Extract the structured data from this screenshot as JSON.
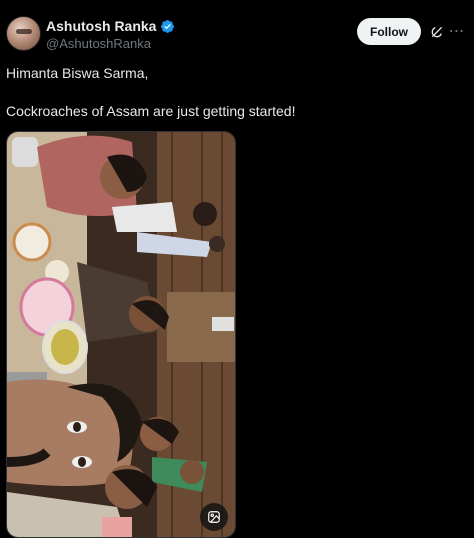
{
  "author": {
    "name": "Ashutosh Ranka",
    "handle": "@AshutoshRanka",
    "verified": true
  },
  "actions": {
    "follow_label": "Follow"
  },
  "post": {
    "line1": "Himanta Biswa Sarma,",
    "line2": "Cockroaches of Assam are just getting started!"
  },
  "colors": {
    "background": "#000000",
    "text": "#e7e9ea",
    "muted": "#71767b",
    "verified": "#1d9bf0",
    "follow_bg": "#eff3f4"
  },
  "icons": {
    "verified": "verified-badge-icon",
    "grok": "grok-icon",
    "more": "more-icon",
    "media_alt": "image-description-icon"
  }
}
